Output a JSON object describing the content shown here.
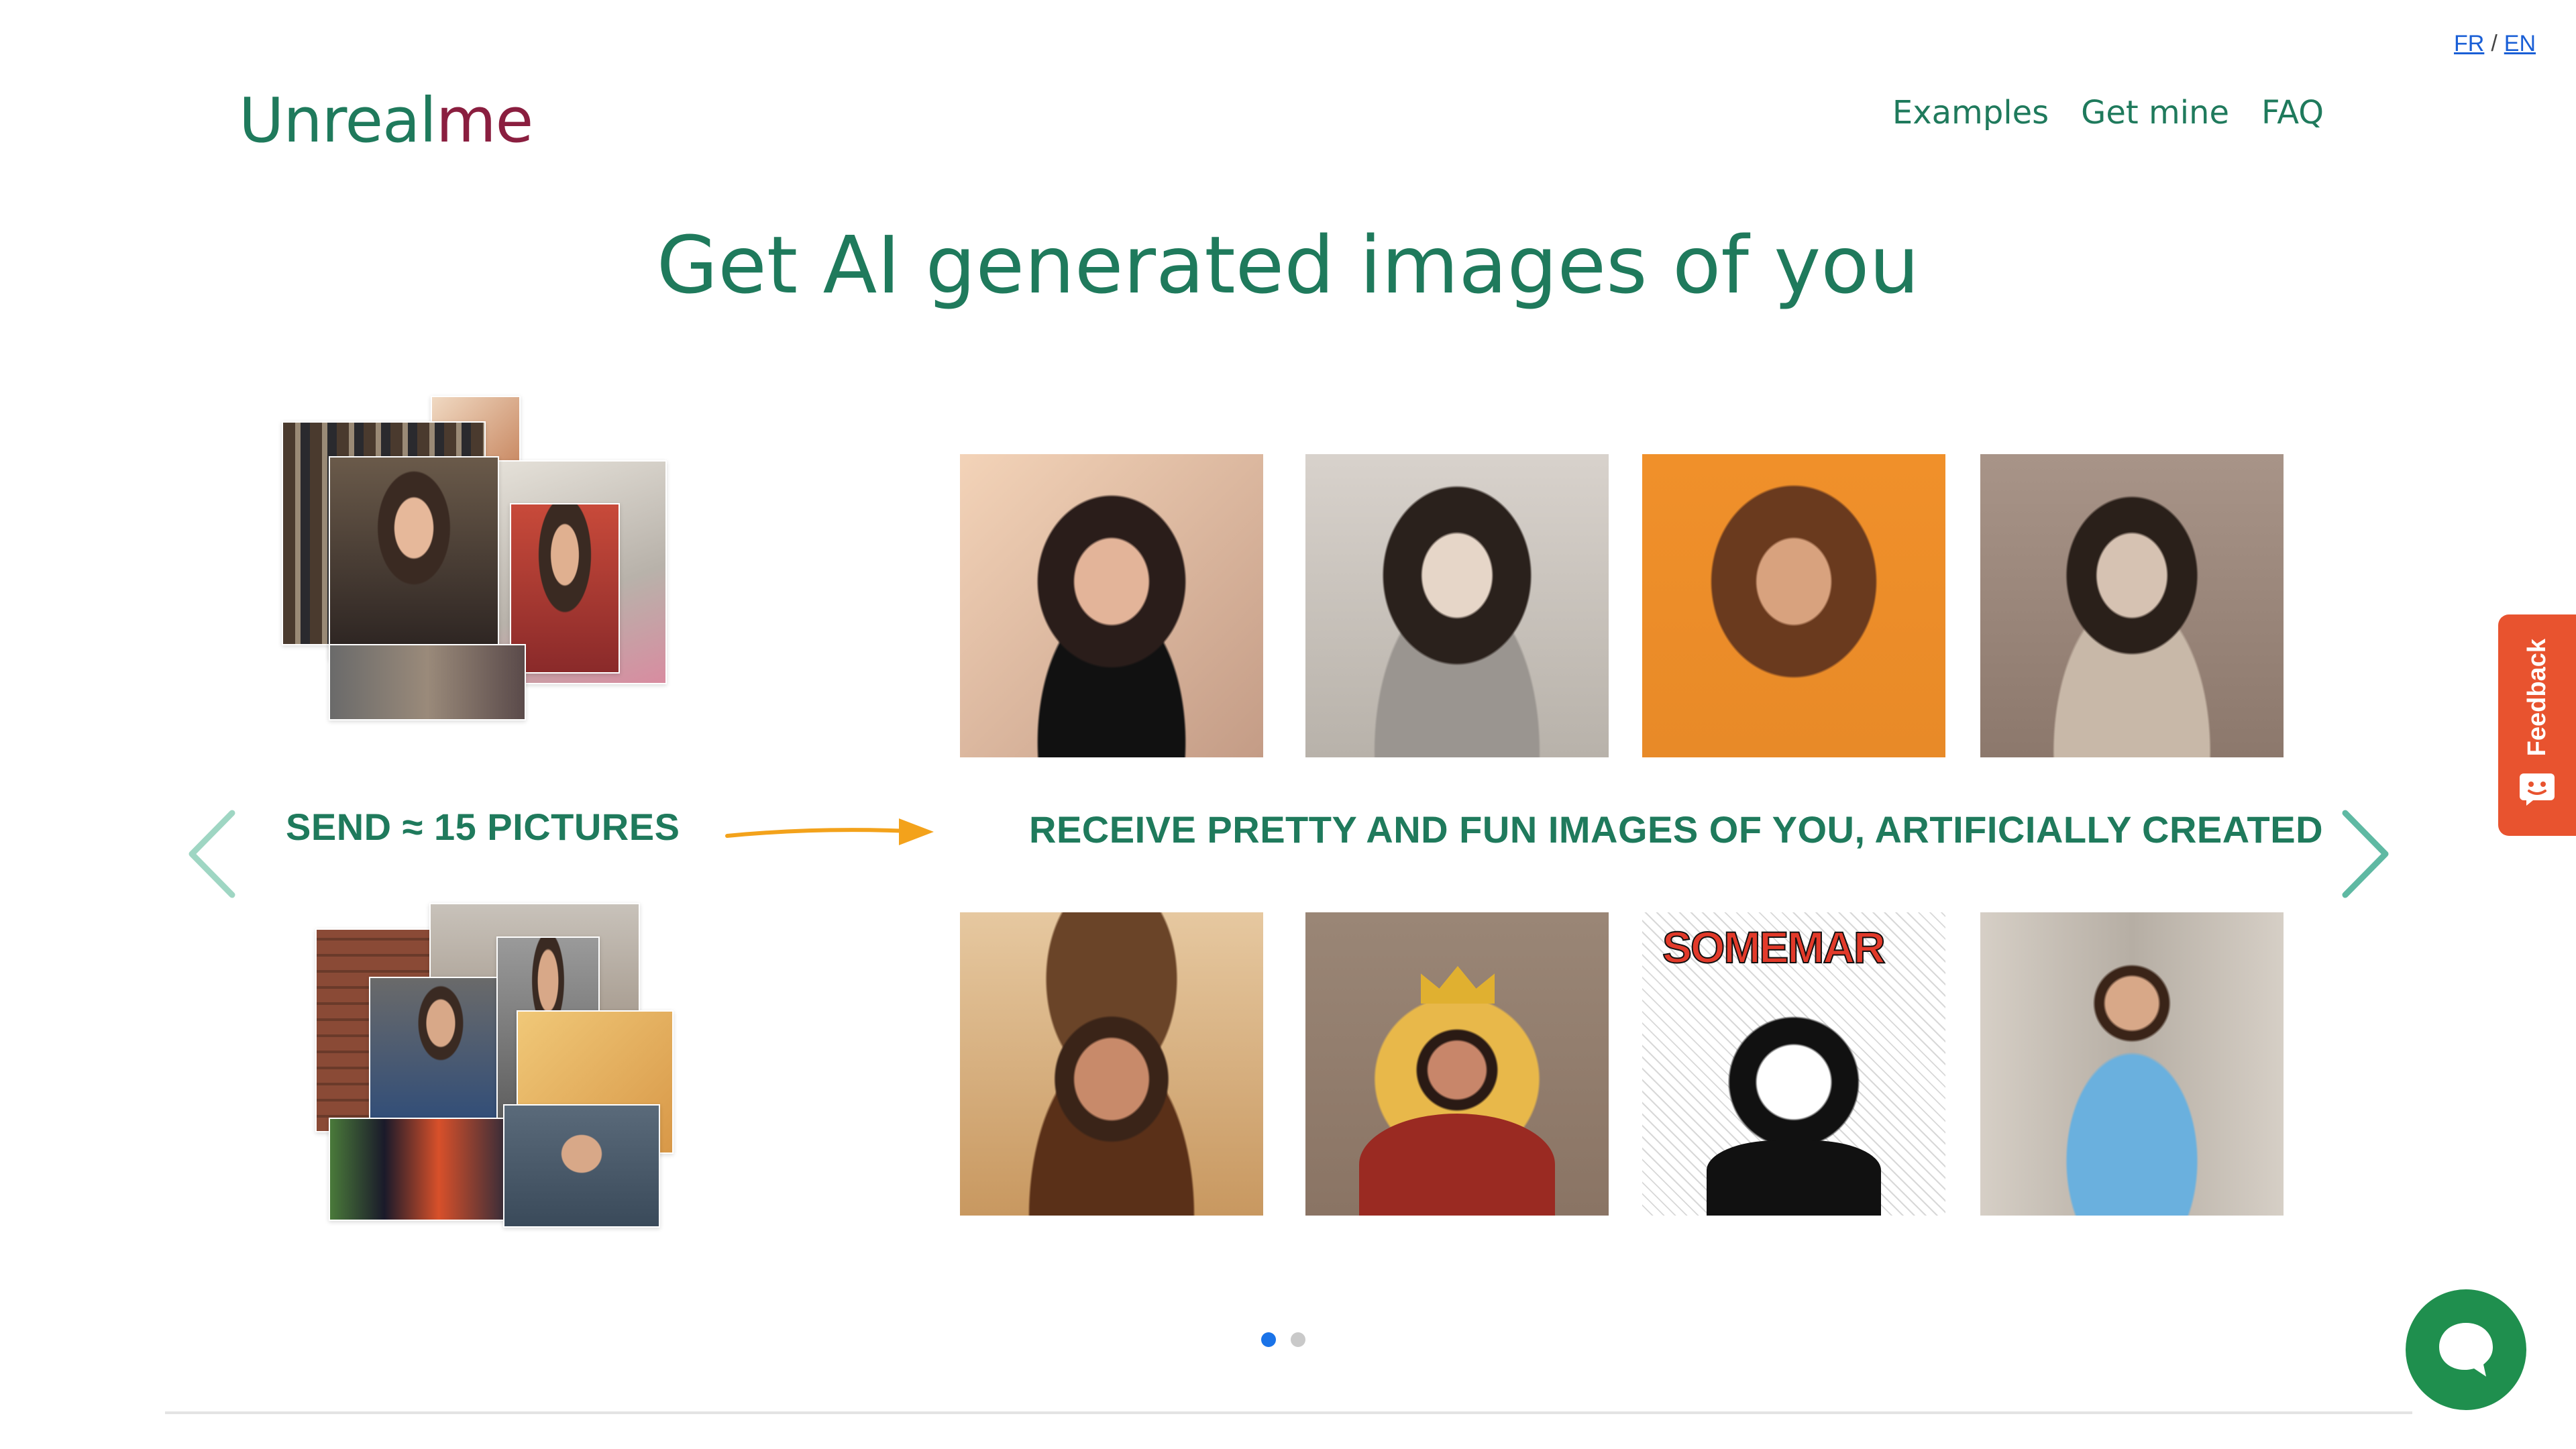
{
  "lang": {
    "fr": "FR",
    "sep": "/",
    "en": "EN"
  },
  "logo": {
    "part1": "Unreal",
    "part2": "me"
  },
  "nav": {
    "examples": "Examples",
    "get_mine": "Get mine",
    "faq": "FAQ"
  },
  "hero": {
    "title": "Get AI generated images of you"
  },
  "steps": {
    "send": "SEND ≈ 15 PICTURES",
    "receive": "RECEIVE PRETTY AND FUN IMAGES OF YOU, ARTIFICIALLY CREATED"
  },
  "feedback": {
    "label": "Feedback"
  },
  "carousel": {
    "slides": 2,
    "active": 1
  },
  "colors": {
    "brand_green": "#1f7a5c",
    "brand_red": "#8a1e3f",
    "arrow_orange": "#f3a21b",
    "feedback_bg": "#e8532f",
    "chat_bg": "#1f8f4e",
    "dot_active": "#1a73e8"
  },
  "icons": {
    "prev": "chevron-left-icon",
    "next": "chevron-right-icon",
    "arrow": "arrow-right-icon",
    "chat": "chat-bubble-icon",
    "feedback": "feedback-face-icon"
  },
  "tiles": {
    "woman": [
      "woman-portrait-smiling",
      "woman-portrait-armor",
      "woman-portrait-orange-bg",
      "woman-portrait-sketch"
    ],
    "man": [
      "man-portrait-cowboy",
      "man-portrait-king-illustration",
      "man-portrait-comic-cover",
      "man-portrait-blue-suit"
    ]
  },
  "comic_title": "SOMEMAR"
}
